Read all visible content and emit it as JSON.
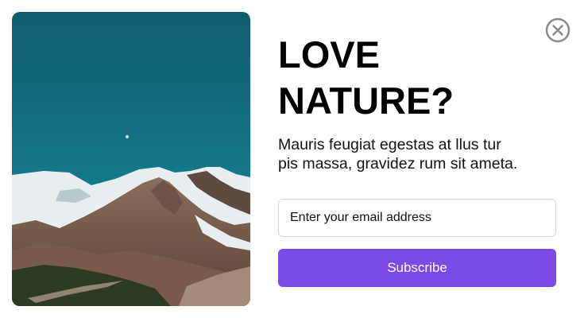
{
  "popup": {
    "title_lines": [
      "LOVE",
      "NATURE?"
    ],
    "description_lines": [
      "Mauris feugiat egestas at llus tur",
      "pis massa, gravidez rum sit ameta."
    ],
    "email_input": {
      "value": "",
      "placeholder": "Enter your email address"
    },
    "subscribe_label": "Subscribe",
    "close_icon": "close-circle-x",
    "hero_image_icon": "mountain-landscape"
  },
  "colors": {
    "accent": "#7b4ae6",
    "sky_top": "#0f5d6f",
    "sky_bottom": "#178898",
    "close_icon": "#8a8a8a",
    "input_border": "#d9d9d9"
  }
}
